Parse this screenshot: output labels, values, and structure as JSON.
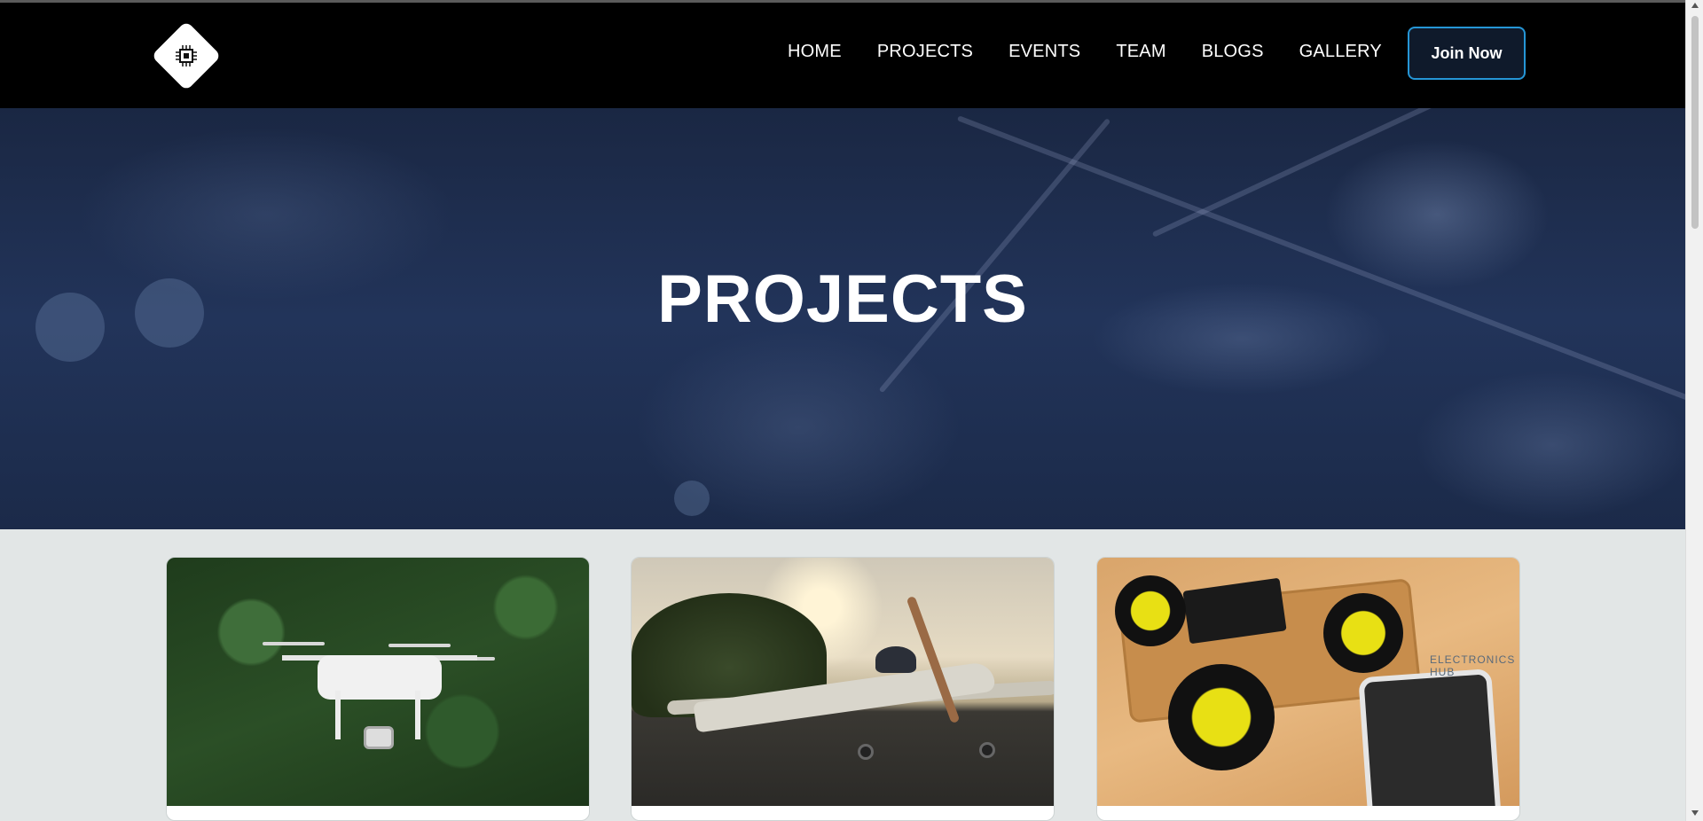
{
  "nav": {
    "logo_icon": "chip-icon",
    "links": [
      "HOME",
      "PROJECTS",
      "EVENTS",
      "TEAM",
      "BLOGS",
      "GALLERY"
    ],
    "cta_label": "Join Now",
    "cta_border_color": "#2596d6"
  },
  "hero": {
    "title": "PROJECTS"
  },
  "projects": {
    "cards": [
      {
        "image": "drone-photo"
      },
      {
        "image": "rc-airplane-photo"
      },
      {
        "image": "robot-car-photo",
        "overlay_text": "ELECTRONICS HUB"
      }
    ]
  },
  "colors": {
    "navbar_bg": "#000000",
    "page_bg": "#e2e6e6",
    "hero_bg": "#1f2f52"
  }
}
